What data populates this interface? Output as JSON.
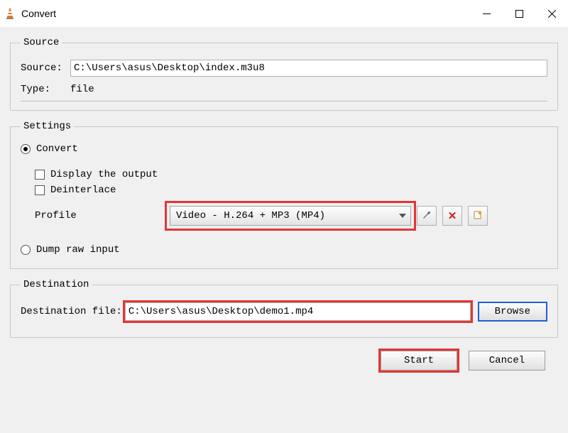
{
  "window": {
    "title": "Convert"
  },
  "source_group": {
    "legend": "Source",
    "source_label": "Source:",
    "source_value": "C:\\Users\\asus\\Desktop\\index.m3u8",
    "type_label": "Type:",
    "type_value": "file"
  },
  "settings_group": {
    "legend": "Settings",
    "convert_label": "Convert",
    "display_output_label": "Display the output",
    "deinterlace_label": "Deinterlace",
    "profile_label": "Profile",
    "profile_value": "Video - H.264 + MP3 (MP4)",
    "dump_label": "Dump raw input"
  },
  "destination_group": {
    "legend": "Destination",
    "dest_label": "Destination file:",
    "dest_value": "C:\\Users\\asus\\Desktop\\demo1.mp4",
    "browse_label": "Browse"
  },
  "buttons": {
    "start": "Start",
    "cancel": "Cancel"
  }
}
